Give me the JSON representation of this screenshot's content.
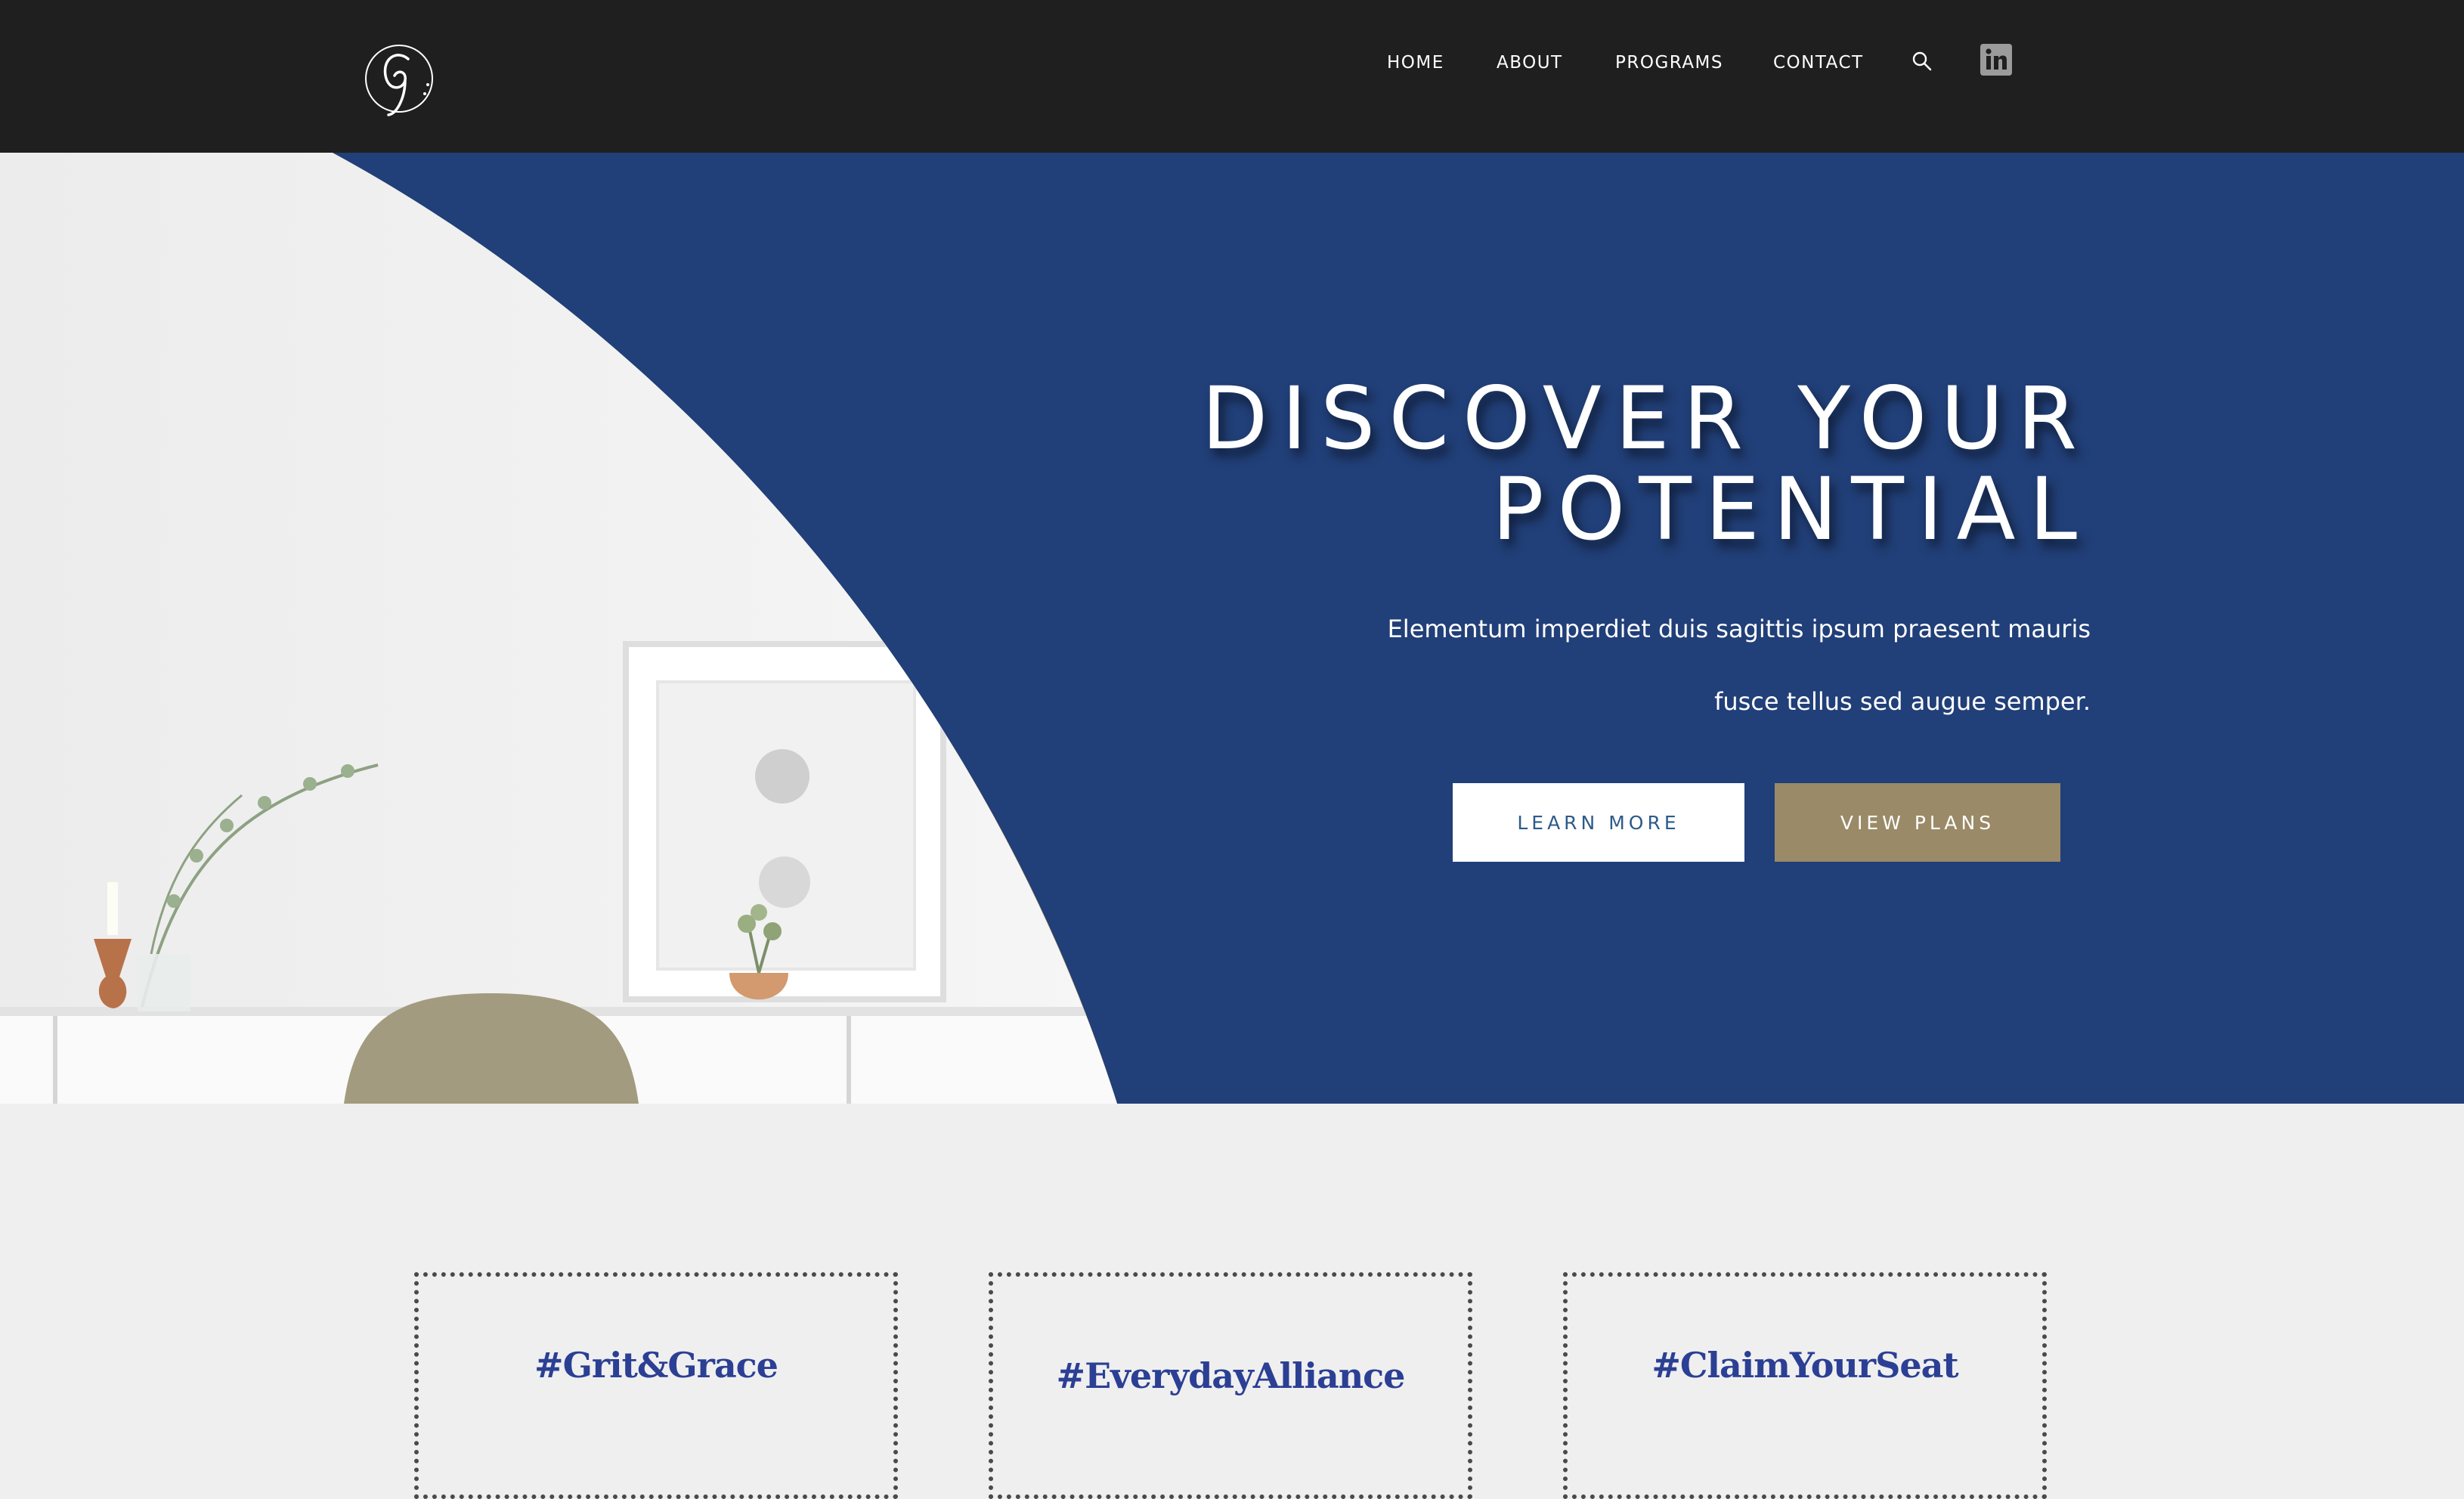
{
  "header": {
    "logo_alt": "G monogram logo",
    "nav": [
      {
        "label": "HOME"
      },
      {
        "label": "ABOUT"
      },
      {
        "label": "PROGRAMS"
      },
      {
        "label": "CONTACT"
      }
    ],
    "icons": {
      "search": "search-icon",
      "social": "linkedin-icon"
    }
  },
  "hero": {
    "title_line1": "DISCOVER YOUR",
    "title_line2": "POTENTIAL",
    "subtitle_line1": "Elementum imperdiet duis sagittis ipsum praesent mauris",
    "subtitle_line2": "fusce tellus sed augue semper.",
    "learn_more_label": "LEARN MORE",
    "view_plans_label": "VIEW PLANS"
  },
  "cards": [
    {
      "tag": "#Grit&Grace"
    },
    {
      "tag": "#EverydayAlliance"
    },
    {
      "tag": "#ClaimYourSeat"
    }
  ],
  "colors": {
    "header_bg": "#1f1f1f",
    "hero_bg": "#213f78",
    "accent_gold": "#9a8a67",
    "card_text": "#2b3f94",
    "page_bg": "#efefef"
  }
}
